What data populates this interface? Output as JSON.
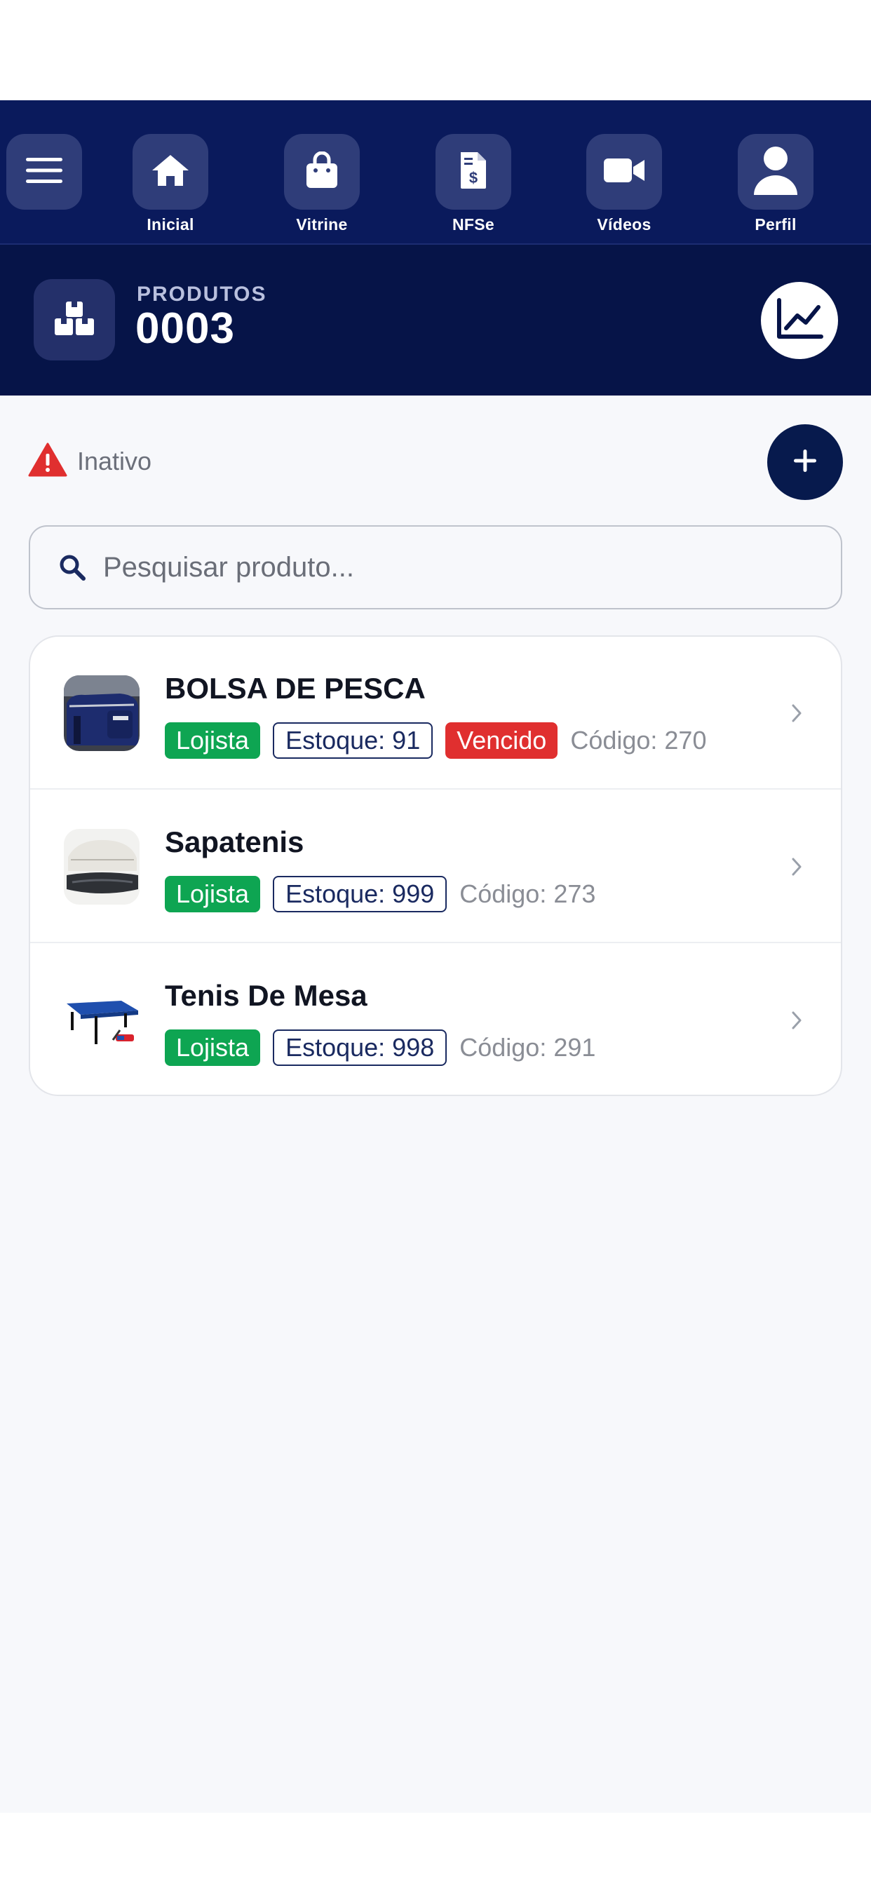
{
  "nav": {
    "menu_icon": "hamburger-icon",
    "items": [
      {
        "label": "Inicial",
        "icon": "home-icon"
      },
      {
        "label": "Vitrine",
        "icon": "shopping-bag-icon"
      },
      {
        "label": "NFSe",
        "icon": "invoice-dollar-icon"
      },
      {
        "label": "Vídeos",
        "icon": "video-camera-icon"
      },
      {
        "label": "Perfil",
        "icon": "user-icon"
      }
    ]
  },
  "header": {
    "caption": "PRODUTOS",
    "count": "0003",
    "icon": "boxes-icon",
    "chart_icon": "line-chart-icon"
  },
  "status": {
    "label": "Inativo",
    "icon": "warning-icon",
    "add_icon": "plus-icon"
  },
  "search": {
    "placeholder": "Pesquisar produto...",
    "value": ""
  },
  "products": [
    {
      "name": "BOLSA DE PESCA",
      "type": "Lojista",
      "stock": "Estoque: 91",
      "expired": "Vencido",
      "code": "Código: 270"
    },
    {
      "name": "Sapatenis",
      "type": "Lojista",
      "stock": "Estoque: 999",
      "code": "Código: 273"
    },
    {
      "name": "Tenis De Mesa",
      "type": "Lojista",
      "stock": "Estoque: 998",
      "code": "Código: 291"
    }
  ],
  "colors": {
    "nav_bg": "#0a1a5c",
    "header_bg": "#061448",
    "badge_green": "#0ea552",
    "badge_red": "#e02f2f",
    "warning": "#e02f2f"
  }
}
